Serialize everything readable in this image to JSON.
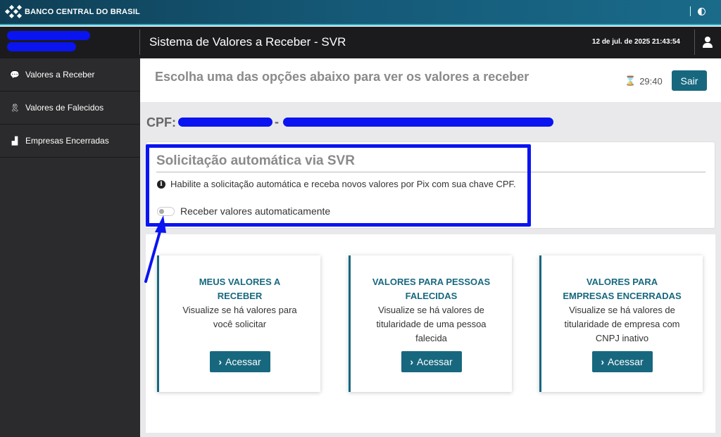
{
  "brand": {
    "name": "BANCO CENTRAL DO BRASIL"
  },
  "header": {
    "title": "Sistema de Valores a Receber - SVR",
    "datetime": "12 de jul. de 2025 21:43:54"
  },
  "sidebar": {
    "items": [
      {
        "label": "Valores a Receber",
        "icon": "money-bubble-icon"
      },
      {
        "label": "Valores de Falecidos",
        "icon": "ribbon-icon"
      },
      {
        "label": "Empresas Encerradas",
        "icon": "factory-icon"
      }
    ]
  },
  "main": {
    "choose_title": "Escolha uma das opções abaixo para ver os valores a receber",
    "timer": "29:40",
    "logout_label": "Sair",
    "cpf_label": "CPF:",
    "cpf_separator": "-"
  },
  "auto": {
    "title": "Solicitação automática via SVR",
    "info": "Habilite a solicitação automática e receba novos valores por Pix com sua chave CPF.",
    "toggle_label": "Receber valores automaticamente",
    "toggle_on": false
  },
  "cards": [
    {
      "title_line1": "MEUS VALORES A",
      "title_line2": "RECEBER",
      "desc": [
        "Visualize se há valores para",
        "você solicitar"
      ],
      "button": "Acessar"
    },
    {
      "title_line1": "VALORES PARA PESSOAS",
      "title_line2": "FALECIDAS",
      "desc": [
        "Visualize se há valores de",
        "titularidade de uma pessoa",
        "falecida"
      ],
      "button": "Acessar"
    },
    {
      "title_line1": "VALORES PARA",
      "title_line2": "EMPRESAS ENCERRADAS",
      "desc": [
        "Visualize se há valores de",
        "titularidade de empresa com",
        "CNPJ inativo"
      ],
      "button": "Acessar"
    }
  ],
  "colors": {
    "accent": "#17687f",
    "annotation": "#0a14f0",
    "sidebar_bg": "#2b2b2d",
    "header_bg": "#1b1b1d"
  }
}
